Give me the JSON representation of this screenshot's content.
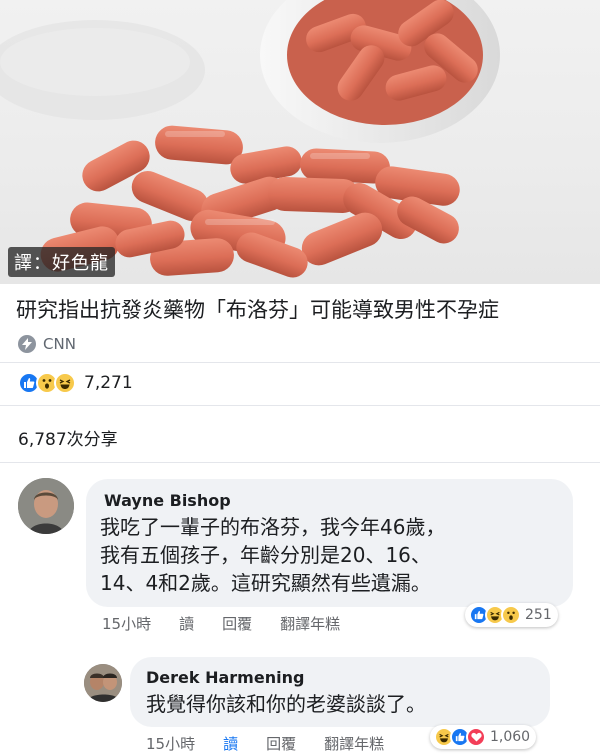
{
  "hero": {
    "watermark": "譯：好色龍"
  },
  "post": {
    "headline": "研究指出抗發炎藥物「布洛芬」可能導致男性不孕症",
    "source_name": "CNN",
    "source_icon": "bolt-icon",
    "reaction_icons": [
      "like-icon",
      "wow-icon",
      "haha-icon"
    ],
    "reaction_count": "7,271",
    "share_count": "6,787次分享"
  },
  "comments": [
    {
      "author": "Wayne Bishop",
      "lines": [
        "我吃了一輩子的布洛芬，我今年46歲，",
        "我有五個孩子，年齡分別是20、16、",
        "14、4和2歲。這研究顯然有些遺漏。"
      ],
      "time": "15小時",
      "read": "讀",
      "reply": "回覆",
      "translate": "翻譯年糕",
      "reactions": [
        "like-icon",
        "haha-icon",
        "wow-icon"
      ],
      "reaction_count": "251"
    },
    {
      "author": "Derek Harmening",
      "lines": [
        "我覺得你該和你的老婆談談了。"
      ],
      "time": "15小時",
      "read": "讀",
      "reply": "回覆",
      "translate": "翻譯年糕",
      "reactions": [
        "haha-icon",
        "like-icon",
        "love-icon"
      ],
      "reaction_count": "1,060"
    }
  ],
  "colors": {
    "like": "#1877f2",
    "love": "#f33e58",
    "emoji": "#f7c94b",
    "bubble": "#f0f2f5",
    "pill": "#e0775f"
  }
}
